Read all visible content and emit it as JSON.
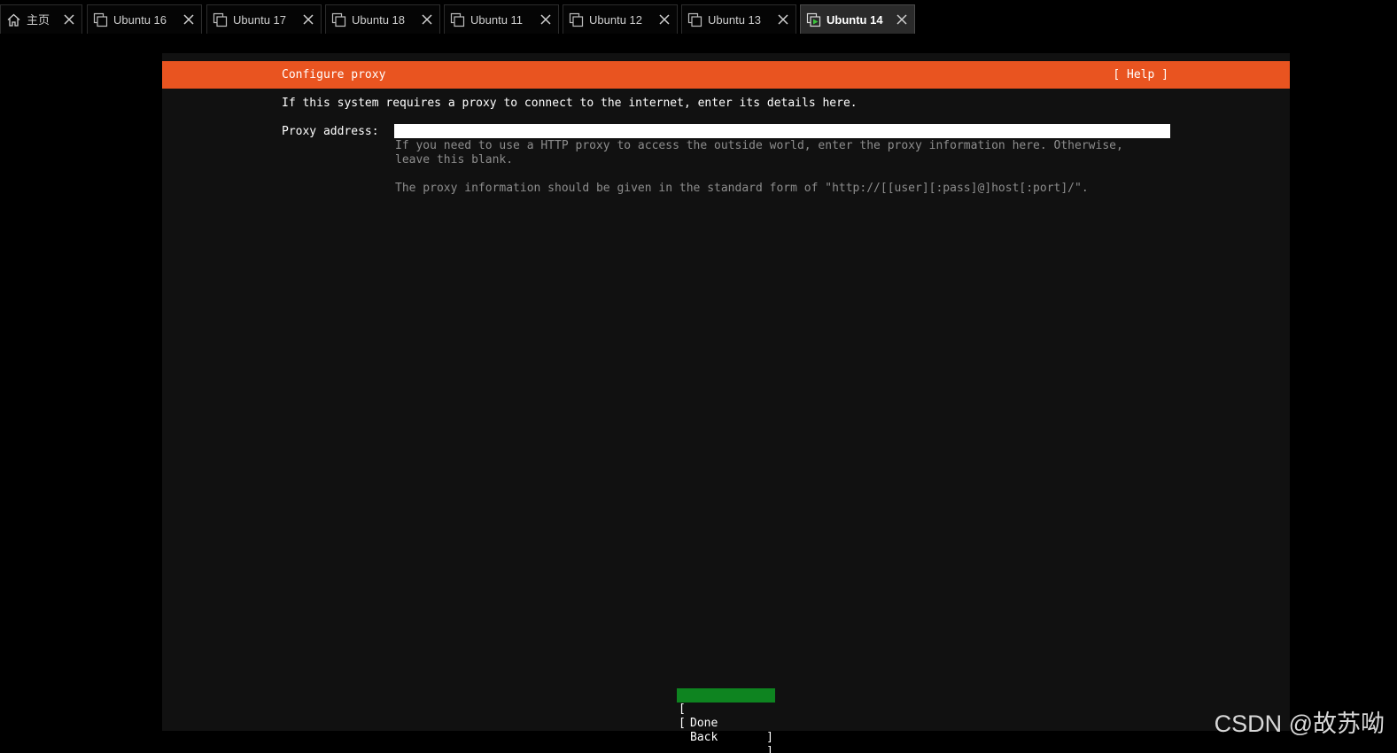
{
  "tabs": [
    {
      "label": "主页",
      "icon": "home-icon",
      "active": false
    },
    {
      "label": "Ubuntu 16",
      "icon": "vm-icon",
      "active": false
    },
    {
      "label": "Ubuntu 17",
      "icon": "vm-icon",
      "active": false
    },
    {
      "label": "Ubuntu 18",
      "icon": "vm-icon",
      "active": false
    },
    {
      "label": "Ubuntu 11",
      "icon": "vm-icon",
      "active": false
    },
    {
      "label": "Ubuntu 12",
      "icon": "vm-icon",
      "active": false
    },
    {
      "label": "Ubuntu 13",
      "icon": "vm-icon",
      "active": false
    },
    {
      "label": "Ubuntu 14",
      "icon": "vm-running-icon",
      "active": true
    }
  ],
  "installer": {
    "title": "Configure proxy",
    "help_label": "[ Help ]",
    "intro": "If this system requires a proxy to connect to the internet, enter its details here.",
    "proxy_label": "Proxy address:",
    "proxy_value": "",
    "help_text": "If you need to use a HTTP proxy to access the outside world, enter the proxy information here. Otherwise,\nleave this blank.",
    "help_text2": "The proxy information should be given in the standard form of \"http://[[user][:pass]@]host[:port]/\".",
    "buttons": {
      "done": "Done",
      "back": "Back",
      "bracket_open": "[",
      "bracket_close": "]"
    }
  },
  "colors": {
    "header": "#e95420",
    "done_button": "#0e8420",
    "console_bg": "#111111",
    "help_text": "#8d8d8d"
  },
  "watermark": "CSDN @故苏呦"
}
